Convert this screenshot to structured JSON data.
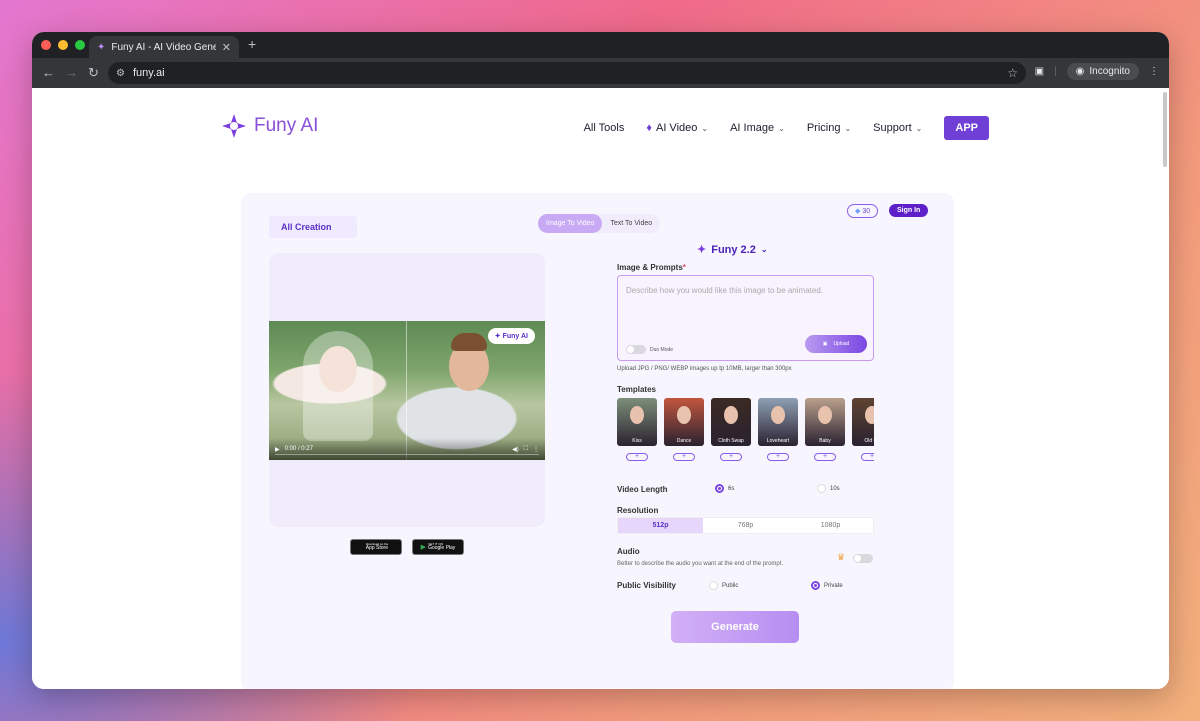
{
  "browser": {
    "tab_title": "Funy AI - AI Video Generator,",
    "url": "funy.ai",
    "incognito_label": "Incognito"
  },
  "header": {
    "logo_text": "Funy AI",
    "nav": {
      "all_tools": "All Tools",
      "ai_video": "AI Video",
      "ai_image": "AI Image",
      "pricing": "Pricing",
      "support": "Support",
      "app": "APP"
    }
  },
  "panel": {
    "all_creation": "All Creation",
    "tabs": [
      "Image To Video",
      "Text To Video"
    ],
    "active_tab": "Image To Video",
    "credits": "30",
    "sign_in": "Sign In",
    "model": "Funy 2.2",
    "video": {
      "watermark": "Funy AI",
      "time": "0:00 / 0:27"
    },
    "stores": {
      "app_store_top": "Download on the",
      "app_store": "App Store",
      "google_play_top": "GET IT ON",
      "google_play": "Google Play"
    },
    "prompt": {
      "label": "Image & Prompts",
      "required_mark": "*",
      "placeholder": "Describe how you would like this image to be animated.",
      "duo_mode": "Duo Mode",
      "upload": "Upload",
      "hint": "Upload JPG / PNG/ WEBP images up tp 10MB, larger than 300px"
    },
    "templates": {
      "label": "Templates",
      "items": [
        {
          "name": "Kiss",
          "color": "#7d8f7a"
        },
        {
          "name": "Dance",
          "color": "#c2563f"
        },
        {
          "name": "Cloth Swap",
          "color": "#3b2a23"
        },
        {
          "name": "Loveheart",
          "color": "#8ea0b5"
        },
        {
          "name": "Baby",
          "color": "#b9a08c"
        },
        {
          "name": "Old Ph",
          "color": "#5e4431"
        }
      ],
      "add_symbol": "+"
    },
    "video_length": {
      "label": "Video Length",
      "options": [
        "6s",
        "10s"
      ],
      "selected": "6s"
    },
    "resolution": {
      "label": "Resolution",
      "options": [
        "512p",
        "768p",
        "1080p"
      ],
      "selected": "512p"
    },
    "audio": {
      "label": "Audio",
      "description": "Better to describe the audio you want at the end of the prompt."
    },
    "visibility": {
      "label": "Public Visibility",
      "options": [
        "Public",
        "Private"
      ],
      "selected": "Private"
    },
    "generate": "Generate"
  },
  "colors": {
    "brand": "#6f3fd6",
    "accent_light": "#e7d6fb"
  }
}
